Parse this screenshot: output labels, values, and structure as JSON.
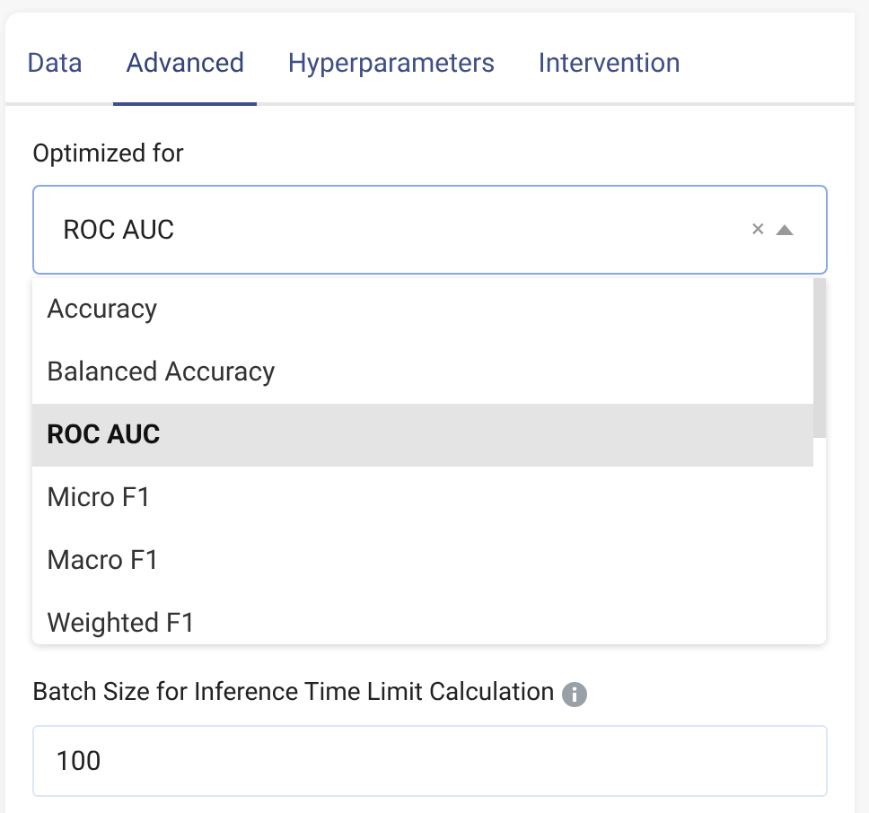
{
  "tabs": [
    {
      "label": "Data",
      "selected": false
    },
    {
      "label": "Advanced",
      "selected": true
    },
    {
      "label": "Hyperparameters",
      "selected": false
    },
    {
      "label": "Intervention",
      "selected": false
    }
  ],
  "optimized_for": {
    "label": "Optimized for",
    "value": "ROC AUC",
    "clear": "×",
    "expanded": true,
    "options": [
      {
        "label": "Accuracy",
        "selected": false
      },
      {
        "label": "Balanced Accuracy",
        "selected": false
      },
      {
        "label": "ROC AUC",
        "selected": true
      },
      {
        "label": "Micro F1",
        "selected": false
      },
      {
        "label": "Macro F1",
        "selected": false
      },
      {
        "label": "Weighted F1",
        "selected": false
      }
    ]
  },
  "batch_size": {
    "label": "Batch Size for Inference Time Limit Calculation",
    "value": "100"
  }
}
